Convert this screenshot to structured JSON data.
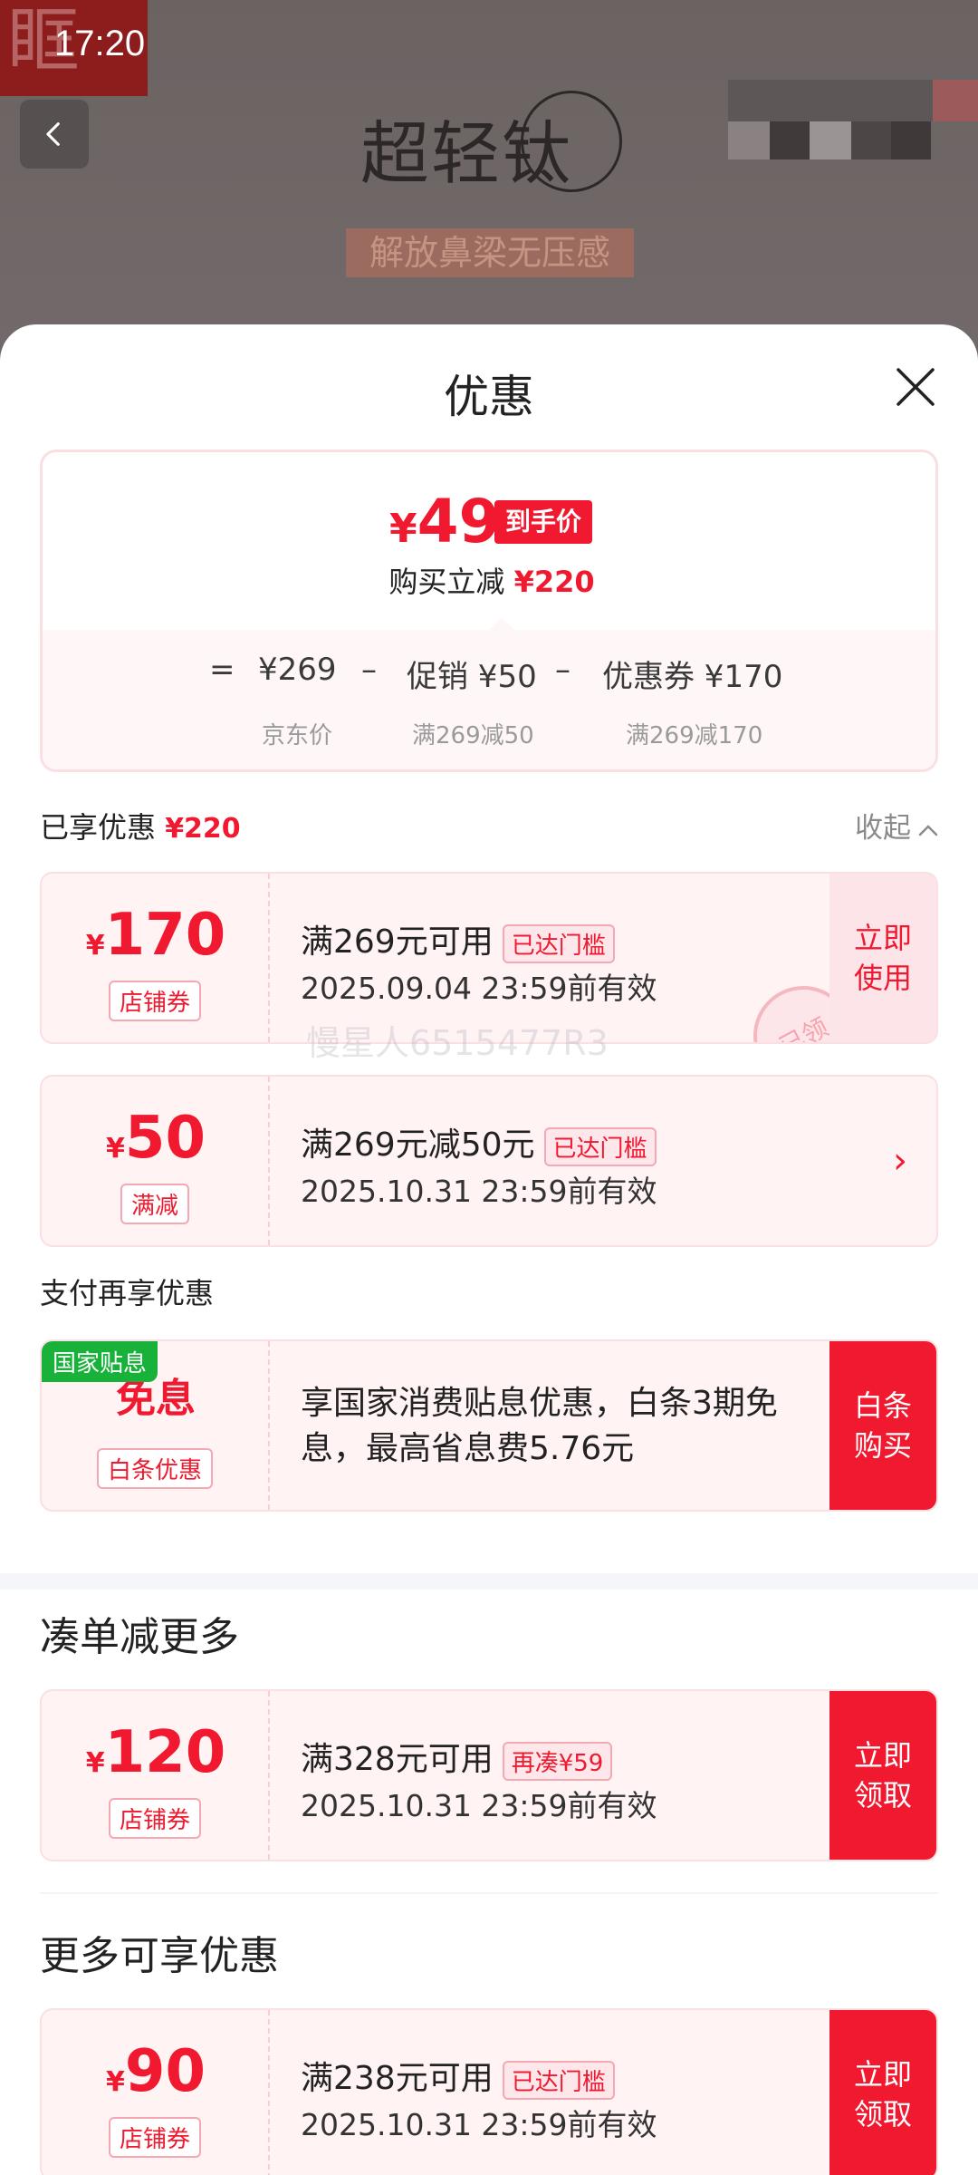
{
  "status_bar": {
    "time": "17:20"
  },
  "background": {
    "logo_glyph": "眶",
    "hero_title": "超轻钛",
    "hero_subtitle": "解放鼻梁无压感"
  },
  "sheet": {
    "title": "优惠",
    "price_summary": {
      "final_price": "49",
      "currency": "¥",
      "final_tag": "到手价",
      "instant_label": "购买立减",
      "instant_amount": "¥220",
      "equals": "=",
      "minus": "–",
      "base_price": "¥269",
      "base_label": "京东价",
      "promo_label": "促销 ¥50",
      "promo_sub": "满269减50",
      "coupon_label": "优惠券 ¥170",
      "coupon_sub": "满269减170"
    },
    "enjoyed": {
      "label": "已享优惠",
      "amount": "¥220",
      "collapse_label": "收起"
    },
    "coupons_enjoyed": [
      {
        "yen": "¥",
        "amount": "170",
        "type": "店铺券",
        "condition": "满269元可用",
        "badge": "已达门槛",
        "date": "2025.09.04 23:59前有效",
        "action": "立即使用",
        "stamp": "已领"
      },
      {
        "yen": "¥",
        "amount": "50",
        "type": "满减",
        "condition": "满269元减50元",
        "badge": "已达门槛",
        "date": "2025.10.31 23:59前有效",
        "action": "›"
      }
    ],
    "watermark": "慢星人6515477R3",
    "pay_section": {
      "label": "支付再享优惠",
      "card": {
        "tag": "国家贴息",
        "amount": "免息",
        "type": "白条优惠",
        "desc": "享国家消费贴息优惠，白条3期免息，最高省息费5.76元",
        "action": "白条购买"
      }
    },
    "bundle_section": {
      "title": "凑单减更多",
      "card": {
        "yen": "¥",
        "amount": "120",
        "type": "店铺券",
        "condition": "满328元可用",
        "badge": "再凑¥59",
        "date": "2025.10.31 23:59前有效",
        "action": "立即领取"
      }
    },
    "more_section": {
      "title": "更多可享优惠",
      "card": {
        "yen": "¥",
        "amount": "90",
        "type": "店铺券",
        "condition": "满238元可用",
        "badge": "已达门槛",
        "date": "2025.10.31 23:59前有效",
        "action": "立即领取"
      }
    }
  },
  "colors": {
    "accent": "#f0192f",
    "green_tag": "#18b23a",
    "coupon_bg": "#fff3f4"
  }
}
